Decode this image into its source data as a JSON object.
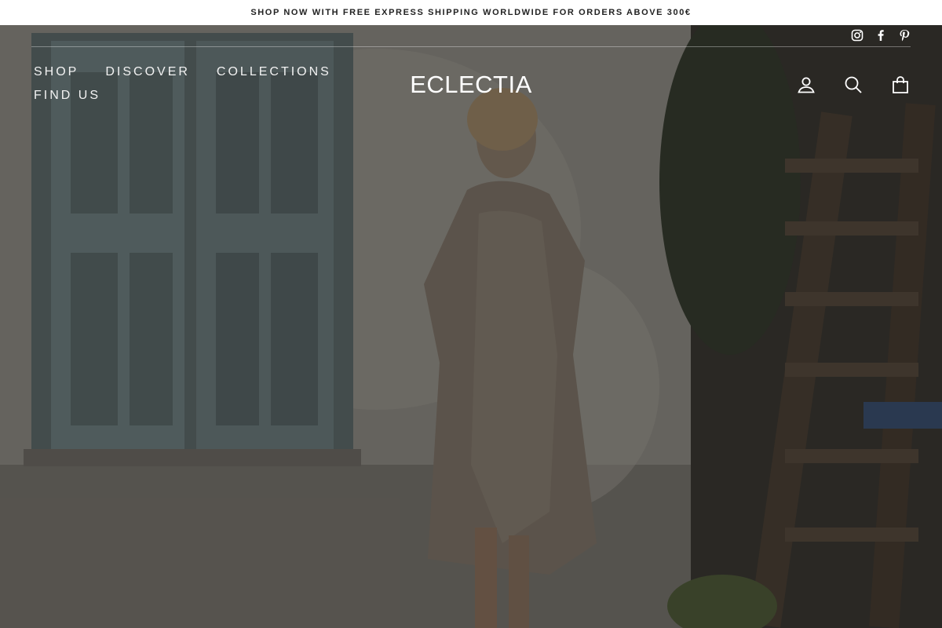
{
  "announcement": {
    "text": "SHOP NOW WITH FREE EXPRESS SHIPPING WORLDWIDE FOR ORDERS ABOVE 300€"
  },
  "brand": {
    "logo_text": "ECLECTIA"
  },
  "nav": {
    "items": [
      {
        "label": "SHOP"
      },
      {
        "label": "DISCOVER"
      },
      {
        "label": "COLLECTIONS"
      },
      {
        "label": "FIND US"
      }
    ]
  },
  "social": {
    "icons": [
      "instagram-icon",
      "facebook-icon",
      "pinterest-icon"
    ]
  },
  "actions": {
    "icons": [
      "account-icon",
      "search-icon",
      "cart-icon"
    ]
  },
  "hero": {
    "image": "woman-in-taupe-dress-against-whitewashed-wall"
  },
  "colors": {
    "announce_bg": "#ffffff",
    "announce_text": "#222222",
    "header_text": "#ffffff"
  }
}
